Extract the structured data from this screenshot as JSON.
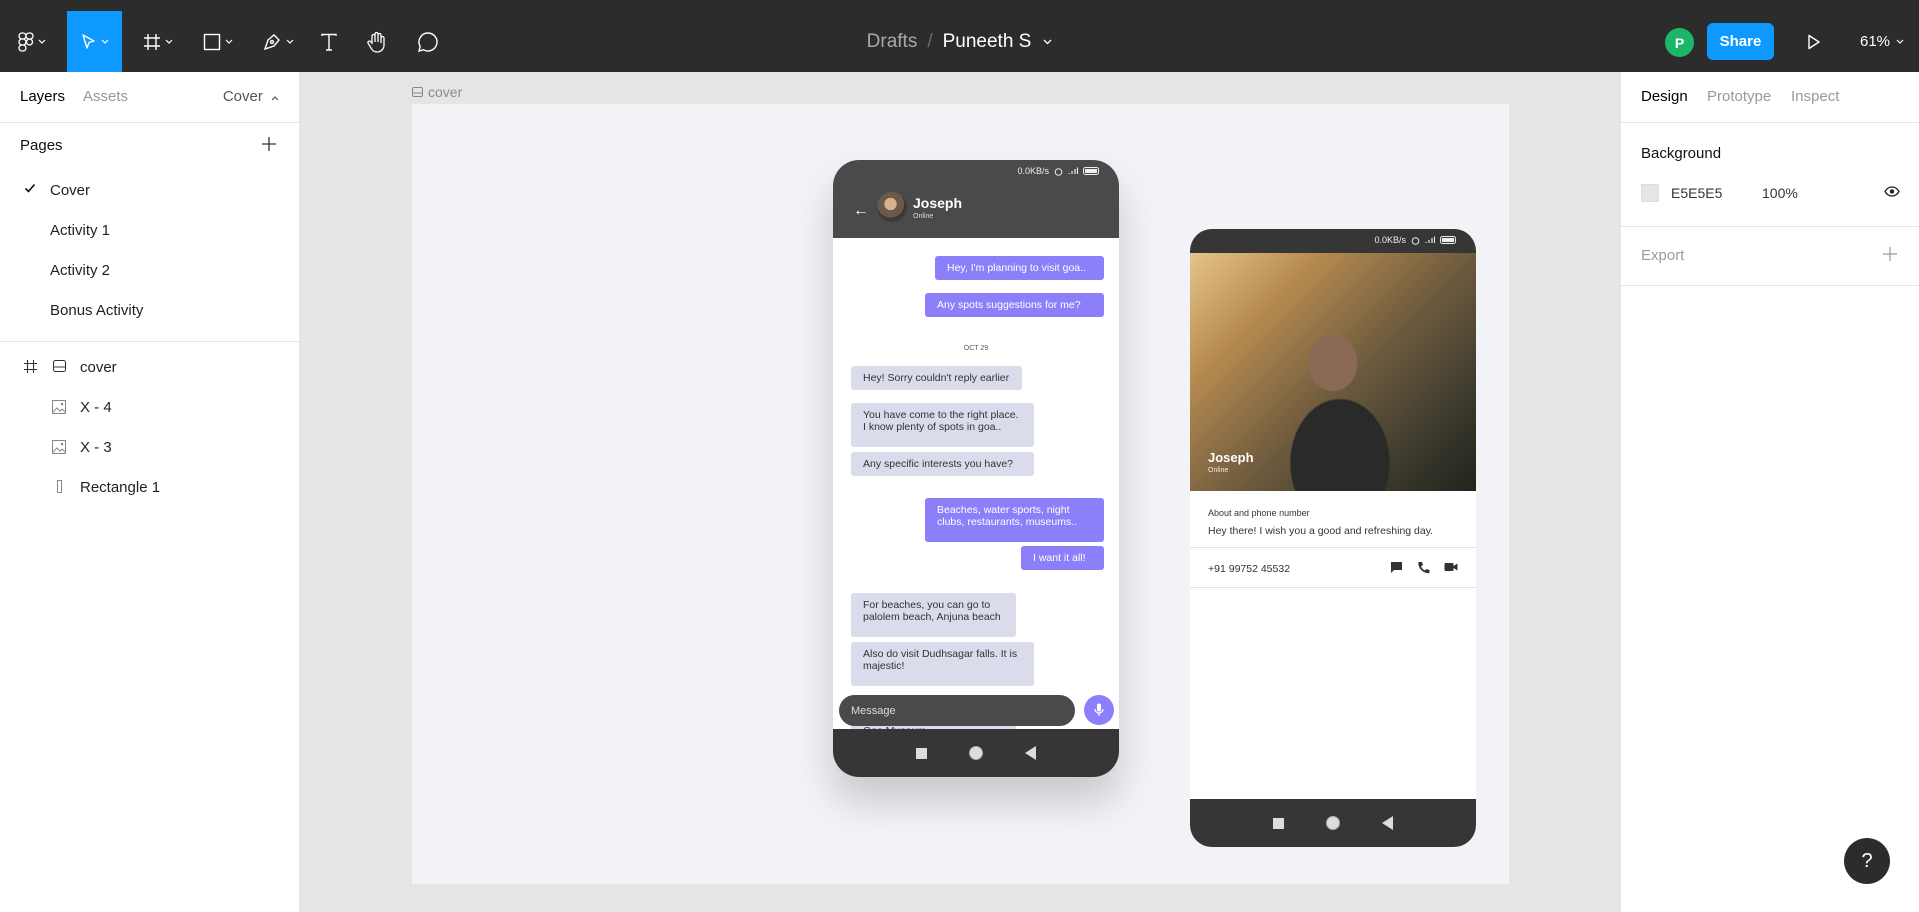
{
  "toolbar": {
    "file": {
      "folder": "Drafts",
      "separator": "/",
      "name": "Puneeth S"
    },
    "user_initial": "P",
    "share_label": "Share",
    "zoom": "61%",
    "tools": [
      "figma-menu-icon",
      "move-tool-icon",
      "frame-tool-icon",
      "shape-tool-icon",
      "pen-tool-icon",
      "text-tool-icon",
      "hand-tool-icon",
      "comment-tool-icon"
    ]
  },
  "left_panel": {
    "tabs": {
      "layers": "Layers",
      "assets": "Assets"
    },
    "page_switch": "Cover",
    "pages_title": "Pages",
    "pages": [
      "Cover",
      "Activity 1",
      "Activity 2",
      "Bonus Activity"
    ],
    "current_page": "Cover",
    "layers": [
      {
        "name": "cover",
        "type": "frame"
      },
      {
        "name": "X - 4",
        "type": "image"
      },
      {
        "name": "X - 3",
        "type": "image"
      },
      {
        "name": "Rectangle 1",
        "type": "rectangle"
      }
    ]
  },
  "canvas": {
    "frame_label": "cover",
    "chat_phone": {
      "status": "0.0KB/s",
      "contact_name": "Joseph",
      "contact_status": "Online",
      "messages": [
        {
          "side": "out",
          "text": "Hey, I'm planning to visit goa.."
        },
        {
          "side": "out",
          "text": "Any spots suggestions for me?"
        },
        {
          "side": "in",
          "text": "Hey! Sorry couldn't reply earlier"
        },
        {
          "side": "in",
          "text": "You have come to the right place. I know plenty of spots in goa.."
        },
        {
          "side": "in",
          "text": "Any specific interests you have?"
        },
        {
          "side": "out",
          "text": "Beaches, water sports,  night clubs, restaurants, museums.."
        },
        {
          "side": "out",
          "text": "I want it all!"
        },
        {
          "side": "in",
          "text": "For beaches, you can go to palolem beach, Anjuna beach"
        },
        {
          "side": "in",
          "text": "Also do visit Dudhsagar falls. It is majestic!"
        },
        {
          "side": "in",
          "text": "Goa Museum"
        }
      ],
      "date_separator": "OCT 29",
      "message_placeholder": "Message"
    },
    "profile_phone": {
      "status": "0.0KB/s",
      "name": "Joseph",
      "online": "Online",
      "about_label": "About and phone number",
      "about_text": "Hey there! I wish you a good and refreshing day.",
      "phone": "+91 99752 45532"
    }
  },
  "right_panel": {
    "tabs": {
      "design": "Design",
      "prototype": "Prototype",
      "inspect": "Inspect"
    },
    "background_title": "Background",
    "bg_hex": "E5E5E5",
    "bg_opacity": "100%",
    "export_title": "Export"
  },
  "help_label": "?",
  "colors": {
    "accent": "#0d99ff",
    "chat_bubble_out": "#8b80f9",
    "chat_bubble_in": "#dadcec",
    "avatar": "#1bb66a"
  }
}
